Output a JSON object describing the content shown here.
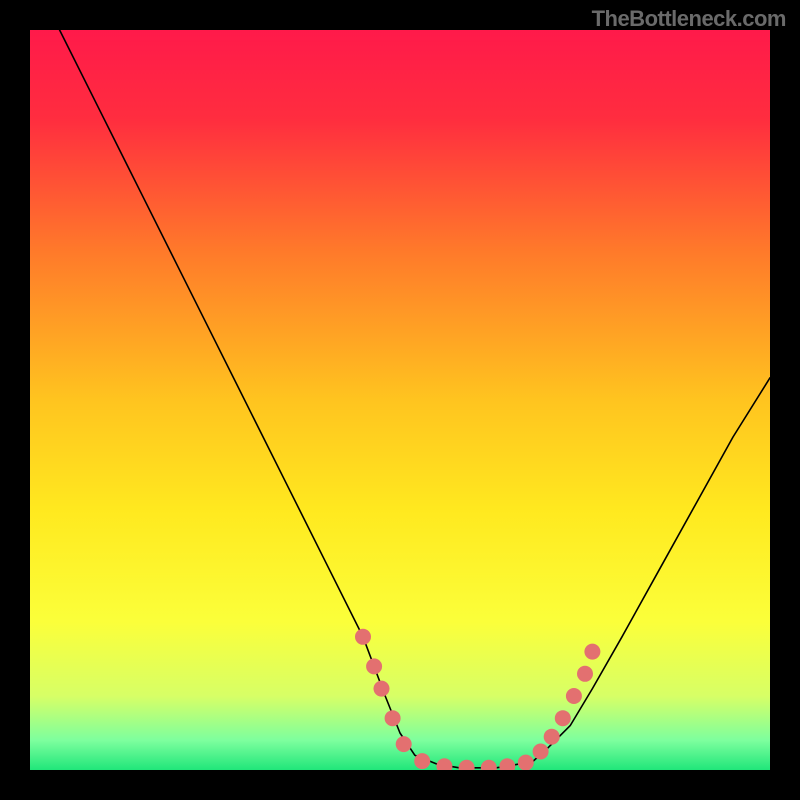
{
  "watermark": "TheBottleneck.com",
  "chart_data": {
    "type": "line",
    "title": "",
    "xlabel": "",
    "ylabel": "",
    "xlim": [
      0,
      100
    ],
    "ylim": [
      0,
      100
    ],
    "background_gradient": {
      "stops": [
        {
          "offset": 0.0,
          "color": "#ff1a4a"
        },
        {
          "offset": 0.12,
          "color": "#ff2d3f"
        },
        {
          "offset": 0.3,
          "color": "#ff7a2a"
        },
        {
          "offset": 0.5,
          "color": "#ffc41f"
        },
        {
          "offset": 0.65,
          "color": "#ffe91f"
        },
        {
          "offset": 0.8,
          "color": "#fbff3a"
        },
        {
          "offset": 0.9,
          "color": "#d7ff66"
        },
        {
          "offset": 0.96,
          "color": "#7dff9e"
        },
        {
          "offset": 1.0,
          "color": "#20e67a"
        }
      ]
    },
    "series": [
      {
        "name": "curve",
        "stroke": "#000000",
        "stroke_width": 1.6,
        "x": [
          4,
          10,
          15,
          20,
          25,
          30,
          35,
          40,
          45,
          48,
          50,
          52,
          55,
          58,
          60,
          63,
          65,
          68,
          70,
          73,
          76,
          80,
          85,
          90,
          95,
          100
        ],
        "y": [
          100,
          88,
          78,
          68,
          58,
          48,
          38,
          28,
          18,
          10,
          5,
          2,
          0.8,
          0.3,
          0.3,
          0.3,
          0.6,
          1.2,
          3,
          6,
          11,
          18,
          27,
          36,
          45,
          53
        ]
      }
    ],
    "markers": {
      "name": "dots",
      "color": "#e37070",
      "radius": 8,
      "points": [
        {
          "x": 45.0,
          "y": 18.0
        },
        {
          "x": 46.5,
          "y": 14.0
        },
        {
          "x": 47.5,
          "y": 11.0
        },
        {
          "x": 49.0,
          "y": 7.0
        },
        {
          "x": 50.5,
          "y": 3.5
        },
        {
          "x": 53.0,
          "y": 1.2
        },
        {
          "x": 56.0,
          "y": 0.5
        },
        {
          "x": 59.0,
          "y": 0.3
        },
        {
          "x": 62.0,
          "y": 0.3
        },
        {
          "x": 64.5,
          "y": 0.5
        },
        {
          "x": 67.0,
          "y": 1.0
        },
        {
          "x": 69.0,
          "y": 2.5
        },
        {
          "x": 70.5,
          "y": 4.5
        },
        {
          "x": 72.0,
          "y": 7.0
        },
        {
          "x": 73.5,
          "y": 10.0
        },
        {
          "x": 75.0,
          "y": 13.0
        },
        {
          "x": 76.0,
          "y": 16.0
        }
      ]
    }
  }
}
